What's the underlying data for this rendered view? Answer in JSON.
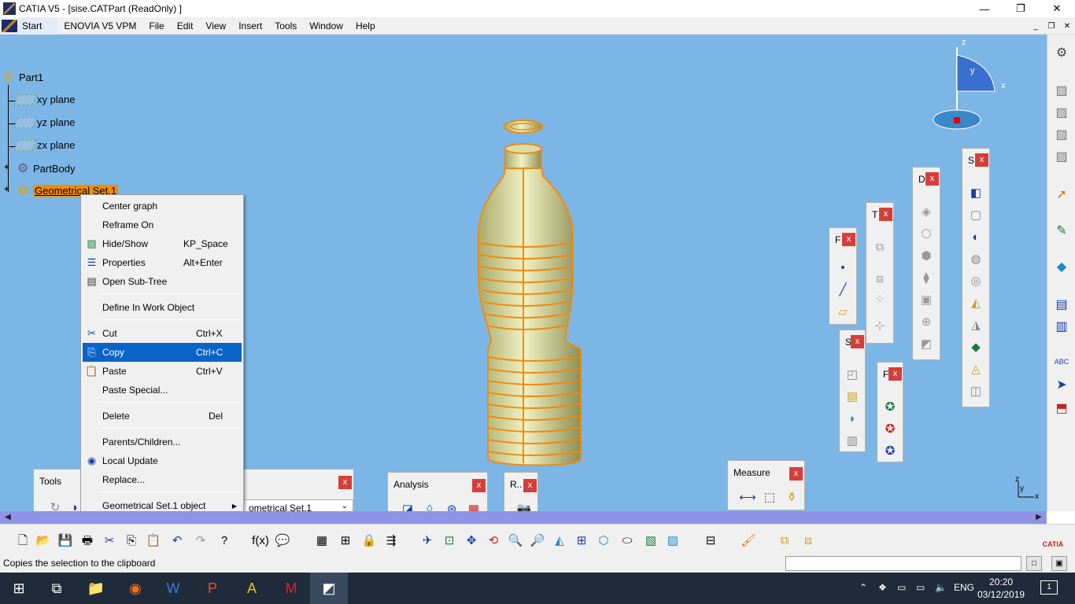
{
  "window": {
    "title": "CATIA V5 - [sise.CATPart (ReadOnly) ]",
    "minimize": "—",
    "maximize": "❐",
    "close": "✕"
  },
  "menubar": {
    "items": [
      "Start",
      "ENOVIA V5 VPM",
      "File",
      "Edit",
      "View",
      "Insert",
      "Tools",
      "Window",
      "Help"
    ],
    "mdi": [
      "_",
      "❐",
      "✕"
    ]
  },
  "tree": {
    "root": "Part1",
    "children": [
      "xy plane",
      "yz plane",
      "zx plane",
      "PartBody",
      "Geometrical Set.1"
    ]
  },
  "context_menu": {
    "items": [
      {
        "label": "Center graph",
        "shortcut": ""
      },
      {
        "label": "Reframe On",
        "shortcut": ""
      },
      {
        "label": "Hide/Show",
        "shortcut": "KP_Space"
      },
      {
        "label": "Properties",
        "shortcut": "Alt+Enter"
      },
      {
        "label": "Open Sub-Tree",
        "shortcut": ""
      },
      {
        "label": "Define In Work Object",
        "shortcut": ""
      },
      {
        "label": "Cut",
        "shortcut": "Ctrl+X"
      },
      {
        "label": "Copy",
        "shortcut": "Ctrl+C"
      },
      {
        "label": "Paste",
        "shortcut": "Ctrl+V"
      },
      {
        "label": "Paste Special...",
        "shortcut": ""
      },
      {
        "label": "Delete",
        "shortcut": "Del"
      },
      {
        "label": "Parents/Children...",
        "shortcut": ""
      },
      {
        "label": "Local Update",
        "shortcut": ""
      },
      {
        "label": "Replace...",
        "shortcut": ""
      },
      {
        "label": "Geometrical Set.1 object",
        "shortcut": ""
      }
    ],
    "highlighted": "Copy"
  },
  "toolbars": {
    "tools": "Tools",
    "tools_combo": "ometrical Set.1",
    "analysis": "Analysis",
    "render": "R..",
    "measure": "Measure",
    "small_titles": [
      "F",
      "T",
      "D",
      "S",
      "S",
      "F"
    ],
    "close": "x"
  },
  "compass": {
    "x": "x",
    "y": "y",
    "z": "z"
  },
  "axis_triad": {
    "x": "x",
    "y": "y",
    "z": "z"
  },
  "status": {
    "message": "Copies the selection to the clipboard"
  },
  "taskbar": {
    "language": "ENG",
    "time": "20:20",
    "date": "03/12/2019",
    "notifications": "1"
  }
}
